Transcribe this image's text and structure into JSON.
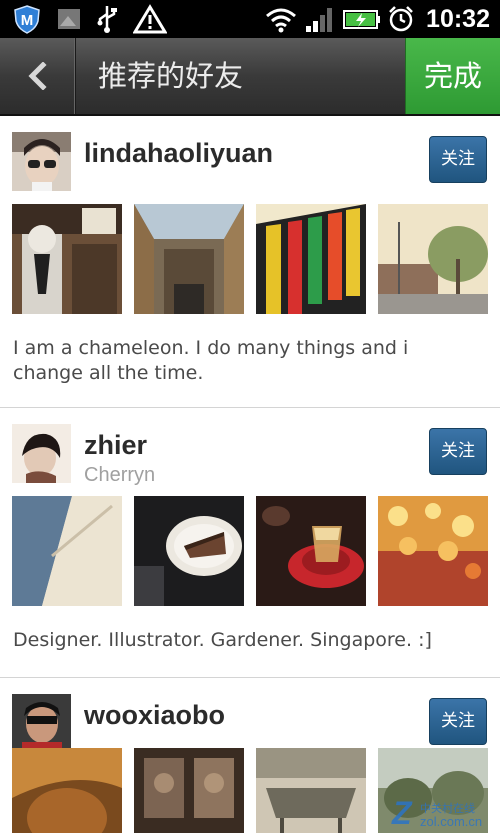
{
  "status_bar": {
    "time": "10:32",
    "icons": [
      "m-shield-icon",
      "image-icon",
      "usb-icon",
      "warning-icon",
      "wifi-icon",
      "signal-icon",
      "battery-charging-icon",
      "alarm-clock-icon"
    ]
  },
  "title_bar": {
    "back_icon": "chevron-left-icon",
    "title": "推荐的好友",
    "done_label": "完成"
  },
  "users": [
    {
      "username": "lindahaoliyuan",
      "subname": "",
      "follow_label": "关注",
      "bio": "I am a chameleon. I do many things and i change all the time.",
      "photo_count": 4
    },
    {
      "username": "zhier",
      "subname": "Cherryn",
      "follow_label": "关注",
      "bio": "Designer. Illustrator. Gardener. Singapore. :]",
      "photo_count": 4
    },
    {
      "username": "wooxiaobo",
      "subname": "",
      "follow_label": "关注",
      "bio": "",
      "photo_count": 4
    }
  ],
  "watermark": {
    "logo": "Z",
    "line1": "中关村在线",
    "line2": "zol.com.cn"
  }
}
